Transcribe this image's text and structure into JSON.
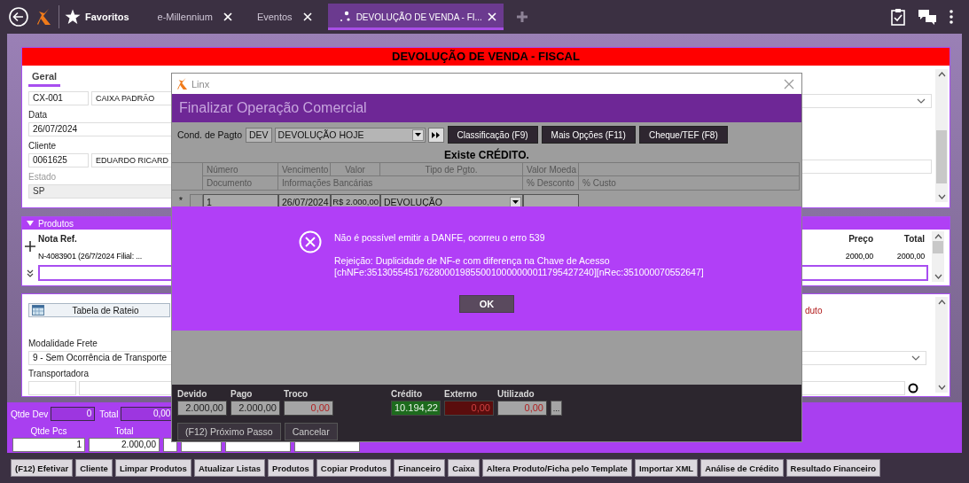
{
  "top_bar": {
    "favorites": "Favoritos",
    "tabs": [
      {
        "label": "e-Millennium",
        "selected": false
      },
      {
        "label": "Eventos",
        "selected": false
      },
      {
        "label": "DEVOLUÇÃO DE VENDA - FI...",
        "selected": true
      }
    ]
  },
  "form": {
    "title": "DEVOLUÇÃO DE VENDA - FISCAL",
    "tab": "Geral",
    "rows": [
      {
        "kind": "pair",
        "code": "CX-001",
        "name": "CAIXA PADRÃO",
        "disabled": false
      },
      {
        "kind": "single",
        "label": "Data",
        "value": "26/07/2024",
        "disabled": false
      },
      {
        "kind": "pair",
        "label": "Cliente",
        "code": "0061625",
        "name": "EDUARDO RICARD",
        "disabled": false
      },
      {
        "kind": "single",
        "label": "Estado",
        "value": "SP",
        "disabled": true
      }
    ]
  },
  "products": {
    "title": "Produtos",
    "columns": [
      "Nota Ref.",
      "Preço",
      "Total"
    ],
    "rows": [
      [
        "N-4083901 (26/7/2024 Filial: ...",
        "2000,00",
        "2000,00"
      ]
    ]
  },
  "freight": {
    "rateio_button": "Tabela de Rateio",
    "note": "duto",
    "mode_label": "Modalidade Frete",
    "mode_value": "9 - Sem Ocorrência de Transporte",
    "carrier_label": "Transportadora"
  },
  "footer": {
    "qty_return": {
      "label": "Qtde Dev",
      "value": "0"
    },
    "total_return": {
      "label": "Total",
      "value": "0,00"
    },
    "qty_pieces": {
      "label": "Qtde Pcs",
      "value": "1"
    },
    "total": {
      "label": "Total",
      "value": "2.000,00"
    }
  },
  "actions": [
    "(F12) Efetivar",
    "Cliente",
    "Limpar Produtos",
    "Atualizar Listas",
    "Produtos",
    "Copiar Produtos",
    "Financeiro",
    "Caixa",
    "Altera Produto/Ficha pelo Template",
    "Importar XML",
    "Análise de Crédito",
    "Resultado Financeiro"
  ],
  "dialog": {
    "window_title": "Linx",
    "title": "Finalizar Operação Comercial",
    "payment": {
      "label": "Cond. de Pagto",
      "code": "DEV",
      "value": "DEVOLUÇÃO HOJE"
    },
    "buttons": [
      "Classificação (F9)",
      "Mais Opções (F11)",
      "Cheque/TEF (F8)"
    ],
    "notice": "Existe CRÉDITO.",
    "grid": {
      "header_1": [
        "Número",
        "Vencimento",
        "Valor",
        "Tipo de Pgto.",
        "Valor Moeda"
      ],
      "header_2": [
        "Documento",
        "Informações Bancárias",
        "% Desconto",
        "% Custo"
      ],
      "row": {
        "marker": "*",
        "number": "1",
        "due": "26/07/2024",
        "amount": "R$ 2.000,00",
        "type": "DEVOLUÇÃO"
      }
    },
    "totals_left": [
      {
        "label": "Devido",
        "value": "2.000,00",
        "kind": "neutral"
      },
      {
        "label": "Pago",
        "value": "2.000,00",
        "kind": "neutral"
      },
      {
        "label": "Troco",
        "value": "0,00",
        "kind": "negative"
      }
    ],
    "totals_right": [
      {
        "label": "Crédito",
        "value": "10.194,22",
        "kind": "credit"
      },
      {
        "label": "Externo",
        "value": "0,00",
        "kind": "debit"
      },
      {
        "label": "Utilizado",
        "value": "0,00",
        "kind": "negative"
      }
    ],
    "more_button": "...",
    "footer_buttons": [
      "(F12) Próximo Passo",
      "Cancelar"
    ]
  },
  "error": {
    "message": "Não é possível emitir a DANFE, ocorreu o erro 539",
    "detail": [
      "Rejeição: Duplicidade de NF-e com diferença na Chave de Acesso",
      "[chNFe:35130554517628000198550010000000011795427240][nRec:351000070552647]"
    ],
    "button": "OK"
  }
}
